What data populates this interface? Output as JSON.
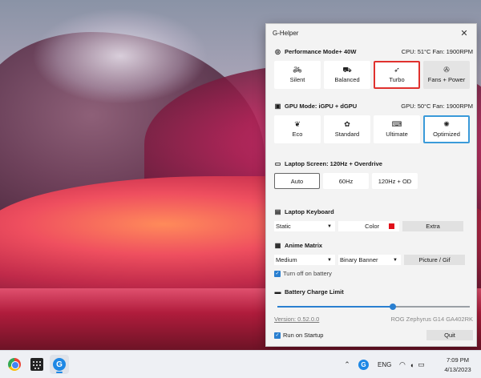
{
  "window": {
    "title": "G-Helper"
  },
  "performance": {
    "title": "Performance Mode+ 40W",
    "stats": "CPU: 51°C  Fan: 1900RPM",
    "modes": [
      {
        "label": "Silent",
        "icon": "bike-icon"
      },
      {
        "label": "Balanced",
        "icon": "car-icon"
      },
      {
        "label": "Turbo",
        "icon": "rocket-icon"
      },
      {
        "label": "Fans + Power",
        "icon": "fan-icon"
      }
    ],
    "selected": "Turbo"
  },
  "gpu": {
    "title": "GPU Mode: iGPU + dGPU",
    "stats": "GPU: 50°C  Fan: 1900RPM",
    "modes": [
      {
        "label": "Eco",
        "icon": "leaf-icon"
      },
      {
        "label": "Standard",
        "icon": "flower-icon"
      },
      {
        "label": "Ultimate",
        "icon": "gamepad-icon"
      },
      {
        "label": "Optimized",
        "icon": "sparkle-icon"
      }
    ],
    "selected": "Optimized"
  },
  "screen": {
    "title": "Laptop Screen: 120Hz + Overdrive",
    "options": [
      "Auto",
      "60Hz",
      "120Hz + OD"
    ],
    "selected": "Auto"
  },
  "keyboard": {
    "title": "Laptop Keyboard",
    "mode": "Static",
    "color_label": "Color",
    "color": "#e0101a",
    "extra_label": "Extra"
  },
  "anime": {
    "title": "Anime Matrix",
    "brightness": "Medium",
    "mode": "Binary Banner",
    "picture_label": "Picture / Gif",
    "battery_off_label": "Turn off on battery",
    "battery_off_checked": true
  },
  "battery": {
    "title": "Battery Charge Limit",
    "limit_fraction": 0.6
  },
  "footer": {
    "version": "Version: 0.52.0.0",
    "model": "ROG Zephyrus G14 GA402RK",
    "startup_label": "Run on Startup",
    "startup_checked": true,
    "quit_label": "Quit"
  },
  "taskbar": {
    "lang": "ENG",
    "time": "7:09 PM",
    "date": "4/13/2023"
  },
  "colors": {
    "turbo_border": "#e0312e",
    "optimized_border": "#3a9ad9",
    "accent": "#2a7fd0"
  }
}
